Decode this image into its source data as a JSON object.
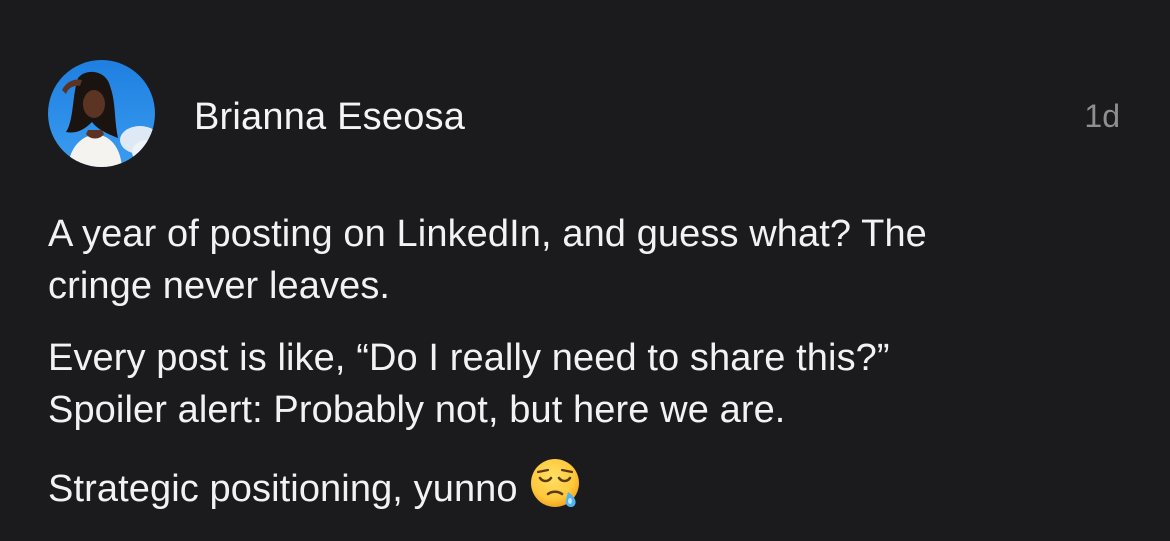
{
  "post": {
    "author_name": "Brianna Eseosa",
    "timestamp": "1d",
    "avatar_icon": "profile-photo-avatar",
    "paragraphs": [
      {
        "lines": [
          "A year of posting on LinkedIn, and guess what? The",
          "cringe never leaves."
        ]
      },
      {
        "lines": [
          "Every post is like, “Do I really need to share this?”",
          "Spoiler alert: Probably not, but here we are."
        ]
      },
      {
        "lines": [
          "Strategic positioning, yunno"
        ],
        "trailing_emoji": "sleepy-face-emoji"
      }
    ]
  },
  "colors": {
    "background": "#1b1b1d",
    "text": "#f2f2f2",
    "muted": "#8e8e93"
  }
}
